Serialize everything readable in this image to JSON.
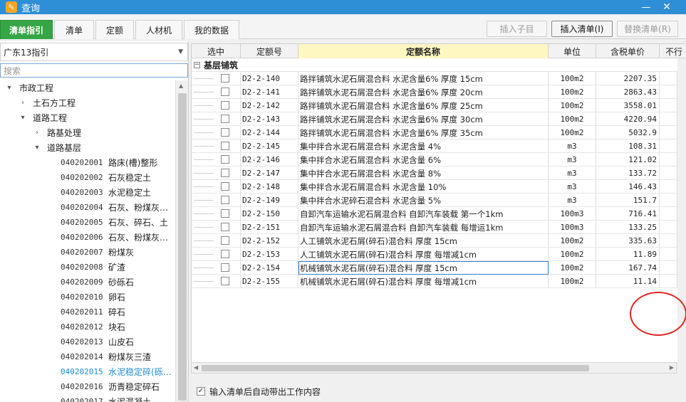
{
  "window": {
    "title": "查询",
    "app_icon": "app-logo-icon",
    "min_glyph": "—",
    "close_glyph": "✕"
  },
  "tabs": [
    {
      "label": "清单指引",
      "active": true
    },
    {
      "label": "清单",
      "active": false
    },
    {
      "label": "定额",
      "active": false
    },
    {
      "label": "人材机",
      "active": false
    },
    {
      "label": "我的数据",
      "active": false
    }
  ],
  "toolbar": {
    "insert_child": "插入子目",
    "insert_list": "插入清单(I)",
    "replace_list": "替换清单(R)"
  },
  "left": {
    "combo_value": "广东13指引",
    "search_placeholder": "搜索",
    "tree": [
      {
        "level": 0,
        "expander": "▾",
        "label": "市政工程"
      },
      {
        "level": 1,
        "expander": "›",
        "label": "土石方工程"
      },
      {
        "level": 1,
        "expander": "▾",
        "label": "道路工程"
      },
      {
        "level": 2,
        "expander": "›",
        "label": "路基处理"
      },
      {
        "level": 2,
        "expander": "▾",
        "label": "道路基层"
      },
      {
        "level": 3,
        "code": "040202001",
        "label": "路床(槽)整形"
      },
      {
        "level": 3,
        "code": "040202002",
        "label": "石灰稳定土"
      },
      {
        "level": 3,
        "code": "040202003",
        "label": "水泥稳定土"
      },
      {
        "level": 3,
        "code": "040202004",
        "label": "石灰、粉煤灰…"
      },
      {
        "level": 3,
        "code": "040202005",
        "label": "石灰、碎石、土"
      },
      {
        "level": 3,
        "code": "040202006",
        "label": "石灰、粉煤灰…"
      },
      {
        "level": 3,
        "code": "040202007",
        "label": "粉煤灰"
      },
      {
        "level": 3,
        "code": "040202008",
        "label": "矿渣"
      },
      {
        "level": 3,
        "code": "040202009",
        "label": "砂砾石"
      },
      {
        "level": 3,
        "code": "040202010",
        "label": "卵石"
      },
      {
        "level": 3,
        "code": "040202011",
        "label": "碎石"
      },
      {
        "level": 3,
        "code": "040202012",
        "label": "块石"
      },
      {
        "level": 3,
        "code": "040202013",
        "label": "山皮石"
      },
      {
        "level": 3,
        "code": "040202014",
        "label": "粉煤灰三渣"
      },
      {
        "level": 3,
        "code": "040202015",
        "label": "水泥稳定碎(砾…",
        "selected": true
      },
      {
        "level": 3,
        "code": "040202016",
        "label": "沥青稳定碎石"
      },
      {
        "level": 3,
        "code": "040202017",
        "label": "水泥混凝土"
      }
    ]
  },
  "grid": {
    "headers": {
      "select": "选中",
      "code": "定额号",
      "name": "定额名称",
      "unit": "单位",
      "price": "含税单价",
      "more": "不行"
    },
    "group_label": "基层铺筑",
    "rows": [
      {
        "code": "D2-2-140",
        "name": "路拌铺筑水泥石屑混合料 水泥含量6% 厚度 15cm",
        "unit": "100m2",
        "price": "2207.35"
      },
      {
        "code": "D2-2-141",
        "name": "路拌铺筑水泥石屑混合料 水泥含量6% 厚度 20cm",
        "unit": "100m2",
        "price": "2863.43"
      },
      {
        "code": "D2-2-142",
        "name": "路拌铺筑水泥石屑混合料 水泥含量6% 厚度 25cm",
        "unit": "100m2",
        "price": "3558.01"
      },
      {
        "code": "D2-2-143",
        "name": "路拌铺筑水泥石屑混合料 水泥含量6% 厚度 30cm",
        "unit": "100m2",
        "price": "4220.94"
      },
      {
        "code": "D2-2-144",
        "name": "路拌铺筑水泥石屑混合料 水泥含量6% 厚度 35cm",
        "unit": "100m2",
        "price": "5032.9"
      },
      {
        "code": "D2-2-145",
        "name": "集中拌合水泥石屑混合料 水泥含量 4%",
        "unit": "m3",
        "price": "108.31"
      },
      {
        "code": "D2-2-146",
        "name": "集中拌合水泥石屑混合料 水泥含量 6%",
        "unit": "m3",
        "price": "121.02"
      },
      {
        "code": "D2-2-147",
        "name": "集中拌合水泥石屑混合料 水泥含量 8%",
        "unit": "m3",
        "price": "133.72"
      },
      {
        "code": "D2-2-148",
        "name": "集中拌合水泥石屑混合料 水泥含量 10%",
        "unit": "m3",
        "price": "146.43"
      },
      {
        "code": "D2-2-149",
        "name": "集中拌合水泥碎石混合料 水泥含量 5%",
        "unit": "m3",
        "price": "151.7"
      },
      {
        "code": "D2-2-150",
        "name": "自卸汽车运输水泥石屑混合料 自卸汽车装载 第一个1km",
        "unit": "100m3",
        "price": "716.41"
      },
      {
        "code": "D2-2-151",
        "name": "自卸汽车运输水泥石屑混合料 自卸汽车装载 每增运1km",
        "unit": "100m3",
        "price": "133.25"
      },
      {
        "code": "D2-2-152",
        "name": "人工铺筑水泥石屑(碎石)混合料 厚度 15cm",
        "unit": "100m2",
        "price": "335.63"
      },
      {
        "code": "D2-2-153",
        "name": "人工铺筑水泥石屑(碎石)混合料 厚度 每增减1cm",
        "unit": "100m2",
        "price": "11.89"
      },
      {
        "code": "D2-2-154",
        "name": "机械铺筑水泥石屑(碎石)混合料 厚度 15cm",
        "unit": "100m2",
        "price": "167.74",
        "focused": true
      },
      {
        "code": "D2-2-155",
        "name": "机械铺筑水泥石屑(碎石)混合料 厚度 每增减1cm",
        "unit": "100m2",
        "price": "11.14"
      }
    ]
  },
  "footer": {
    "checkbox_label": "输入清单后自动带出工作内容",
    "checked": true,
    "check_glyph": "✓"
  },
  "colors": {
    "titlebar": "#2f8fd6",
    "active_tab": "#36a546",
    "selected_tree": "#1e8bd6",
    "annotation": "#e02424"
  }
}
